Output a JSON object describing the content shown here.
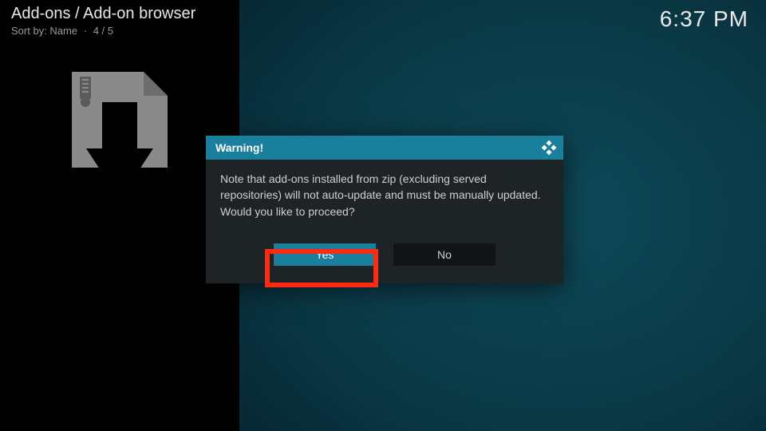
{
  "header": {
    "breadcrumb": "Add-ons / Add-on browser",
    "sort_label": "Sort by: Name",
    "sort_index": "4 / 5"
  },
  "clock": "6:37 PM",
  "sidebar": {
    "icon_name": "zip-install-icon"
  },
  "dialog": {
    "title": "Warning!",
    "body": "Note that add-ons installed from zip (excluding served repositories) will not auto-update and must be manually updated. Would you like to proceed?",
    "yes_label": "Yes",
    "no_label": "No"
  },
  "colors": {
    "accent": "#1a7f9c",
    "highlight": "#ff2a12",
    "panel_bg": "#1e2326"
  }
}
